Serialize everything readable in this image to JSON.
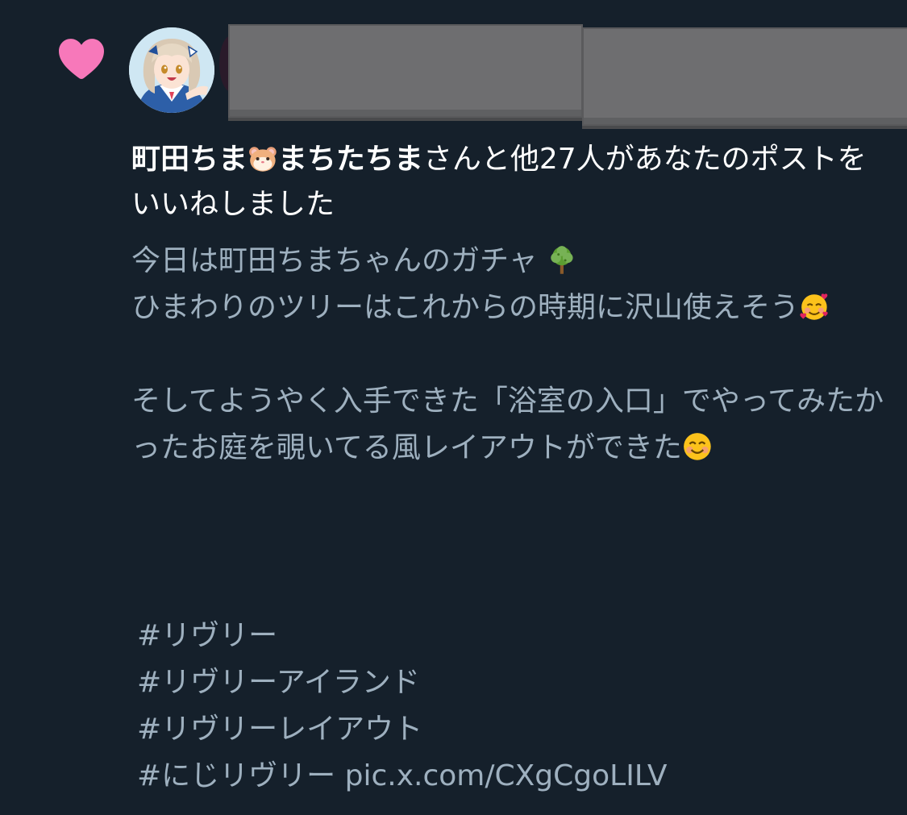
{
  "notification": {
    "icon": "heart-icon",
    "icon_color": "#f778ba",
    "names_part1": "町田ちま",
    "names_emoji": "hamster-emoji",
    "names_part2": "まちたちま",
    "action_text": "さんと他27人があなたのポストをいいねしました"
  },
  "post": {
    "line1": "今日は町田ちまちゃんのガチャ",
    "line1_emoji": "tree-emoji",
    "line2": "ひまわりのツリーはこれからの時期に沢山使えそう",
    "line2_emoji": "smiling-face-with-hearts-emoji",
    "line3": "そしてようやく入手できた「浴室の入口」でやってみたかったお庭を覗いてる風レイアウトができた",
    "line3_emoji": "smiling-face-emoji",
    "hashtags": [
      "#リヴリー",
      "#リヴリーアイランド",
      "#リヴリーレイアウト",
      "#にじリヴリー"
    ],
    "link": "pic.x.com/CXgCgoLILV"
  },
  "colors": {
    "background": "#15202b",
    "headline_text": "#ffffff",
    "body_text": "#9eb0bf",
    "redaction": "#6e6e70"
  }
}
